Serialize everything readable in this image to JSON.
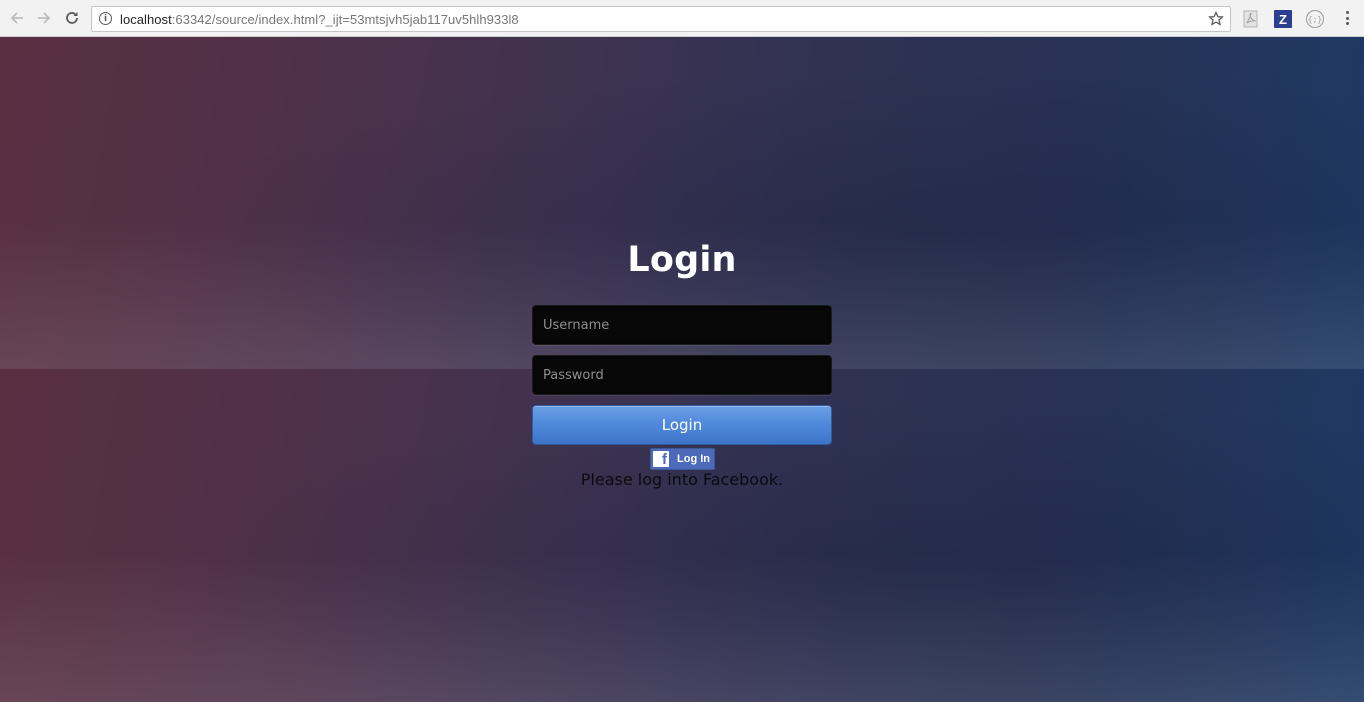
{
  "browser": {
    "url_host": "localhost",
    "url_rest": ":63342/source/index.html?_ijt=53mtsjvh5jab117uv5hlh933l8",
    "info_icon": "i",
    "extensions": [
      {
        "name": "pdf-icon"
      },
      {
        "name": "z-icon",
        "label": "Z"
      },
      {
        "name": "code-icon",
        "label": "{;}"
      }
    ]
  },
  "login": {
    "title": "Login",
    "username_placeholder": "Username",
    "password_placeholder": "Password",
    "button_label": "Login",
    "facebook_button_label": "Log In",
    "facebook_logo": "f",
    "status": "Please log into Facebook."
  },
  "colors": {
    "login_button": "#4f88da",
    "facebook_button": "#4c69ba",
    "field_background": "#080808"
  }
}
